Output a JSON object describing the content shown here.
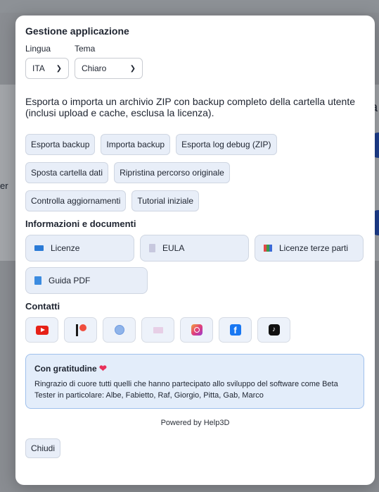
{
  "background": {
    "right_text": "a",
    "left_text": "er"
  },
  "modal": {
    "title": "Gestione applicazione",
    "language": {
      "label": "Lingua",
      "value": "ITA"
    },
    "theme": {
      "label": "Tema",
      "value": "Chiaro"
    },
    "description": "Esporta o importa un archivio ZIP con backup completo della cartella utente (inclusi upload e cache, esclusa la licenza).",
    "actions": [
      [
        "Esporta backup",
        "Importa backup",
        "Esporta log debug (ZIP)"
      ],
      [
        "Sposta cartella dati",
        "Ripristina percorso originale"
      ],
      [
        "Controlla aggiornamenti",
        "Tutorial iniziale"
      ]
    ],
    "docs_title": "Informazioni e documenti",
    "docs": [
      {
        "label": "Licenze",
        "icon": "id-card-icon"
      },
      {
        "label": "EULA",
        "icon": "document-icon"
      },
      {
        "label": "Licenze terze parti",
        "icon": "books-icon"
      },
      {
        "label": "Guida PDF",
        "icon": "book-icon"
      }
    ],
    "contacts_title": "Contatti",
    "contacts": [
      "youtube-icon",
      "patreon-icon",
      "globe-icon",
      "mail-icon",
      "instagram-icon",
      "facebook-icon",
      "tiktok-icon"
    ],
    "thanks": {
      "title": "Con gratitudine",
      "text": "Ringrazio di cuore tutti quelli che hanno partecipato allo sviluppo del software come Beta Tester in particolare: Albe, Fabietto, Raf, Giorgio, Pitta, Gab, Marco"
    },
    "powered": "Powered by Help3D",
    "close_label": "Chiudi"
  },
  "colors": {
    "accent_bg": "#e8eef8",
    "thanks_bg": "#e3edfa",
    "heart": "#e8305a"
  }
}
